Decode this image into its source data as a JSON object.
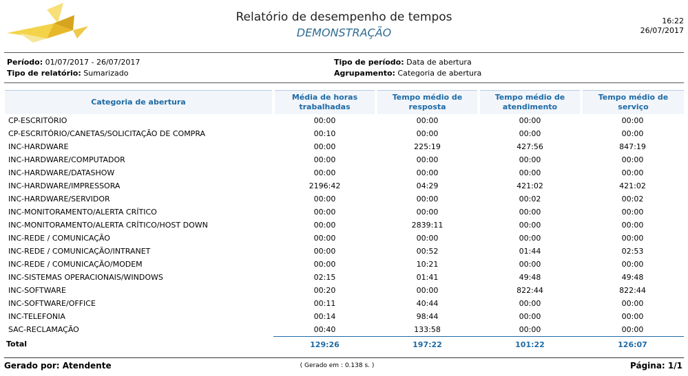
{
  "header": {
    "title": "Relatório de desempenho de tempos",
    "subtitle": "DEMONSTRAÇÃO",
    "time": "16:22",
    "date": "26/07/2017"
  },
  "meta": {
    "periodo_label": "Período:",
    "periodo_value": "01/07/2017 - 26/07/2017",
    "tipo_relatorio_label": "Tipo de relatório:",
    "tipo_relatorio_value": "Sumarizado",
    "tipo_periodo_label": "Tipo de período:",
    "tipo_periodo_value": "Data de abertura",
    "agrupamento_label": "Agrupamento:",
    "agrupamento_value": "Categoria de abertura"
  },
  "table": {
    "headers": [
      "Categoria de abertura",
      "Média de horas trabalhadas",
      "Tempo médio de resposta",
      "Tempo médio de atendimento",
      "Tempo médio de serviço"
    ],
    "rows": [
      [
        "CP-ESCRITÓRIO",
        "00:00",
        "00:00",
        "00:00",
        "00:00"
      ],
      [
        "CP-ESCRITÓRIO/CANETAS/SOLICITAÇÃO DE COMPRA",
        "00:10",
        "00:00",
        "00:00",
        "00:00"
      ],
      [
        "INC-HARDWARE",
        "00:00",
        "225:19",
        "427:56",
        "847:19"
      ],
      [
        "INC-HARDWARE/COMPUTADOR",
        "00:00",
        "00:00",
        "00:00",
        "00:00"
      ],
      [
        "INC-HARDWARE/DATASHOW",
        "00:00",
        "00:00",
        "00:00",
        "00:00"
      ],
      [
        "INC-HARDWARE/IMPRESSORA",
        "2196:42",
        "04:29",
        "421:02",
        "421:02"
      ],
      [
        "INC-HARDWARE/SERVIDOR",
        "00:00",
        "00:00",
        "00:02",
        "00:02"
      ],
      [
        "INC-MONITORAMENTO/ALERTA CRÍTICO",
        "00:00",
        "00:00",
        "00:00",
        "00:00"
      ],
      [
        "INC-MONITORAMENTO/ALERTA CRÍTICO/HOST DOWN",
        "00:00",
        "2839:11",
        "00:00",
        "00:00"
      ],
      [
        "INC-REDE / COMUNICAÇÃO",
        "00:00",
        "00:00",
        "00:00",
        "00:00"
      ],
      [
        "INC-REDE / COMUNICAÇÃO/INTRANET",
        "00:00",
        "00:52",
        "01:44",
        "02:53"
      ],
      [
        "INC-REDE / COMUNICAÇÃO/MODEM",
        "00:00",
        "10:21",
        "00:00",
        "00:00"
      ],
      [
        "INC-SISTEMAS OPERACIONAIS/WINDOWS",
        "02:15",
        "01:41",
        "49:48",
        "49:48"
      ],
      [
        "INC-SOFTWARE",
        "00:20",
        "00:00",
        "822:44",
        "822:44"
      ],
      [
        "INC-SOFTWARE/OFFICE",
        "00:11",
        "40:44",
        "00:00",
        "00:00"
      ],
      [
        "INC-TELEFONIA",
        "00:14",
        "98:44",
        "00:00",
        "00:00"
      ],
      [
        "SAC-RECLAMAÇÃO",
        "00:40",
        "133:58",
        "00:00",
        "00:00"
      ]
    ],
    "total": [
      "Total",
      "129:26",
      "197:22",
      "101:22",
      "126:07"
    ]
  },
  "footer": {
    "generated_by": "Gerado por: Atendente",
    "generated_in": "( Gerado em : 0.138 s. )",
    "page": "Página: 1/1"
  },
  "colors": {
    "accent": "#1d6aa5",
    "subtitle": "#2f6c93",
    "header_bg": "#f2f5fa"
  },
  "icons": {
    "logo": "paper-airplane-logo"
  }
}
